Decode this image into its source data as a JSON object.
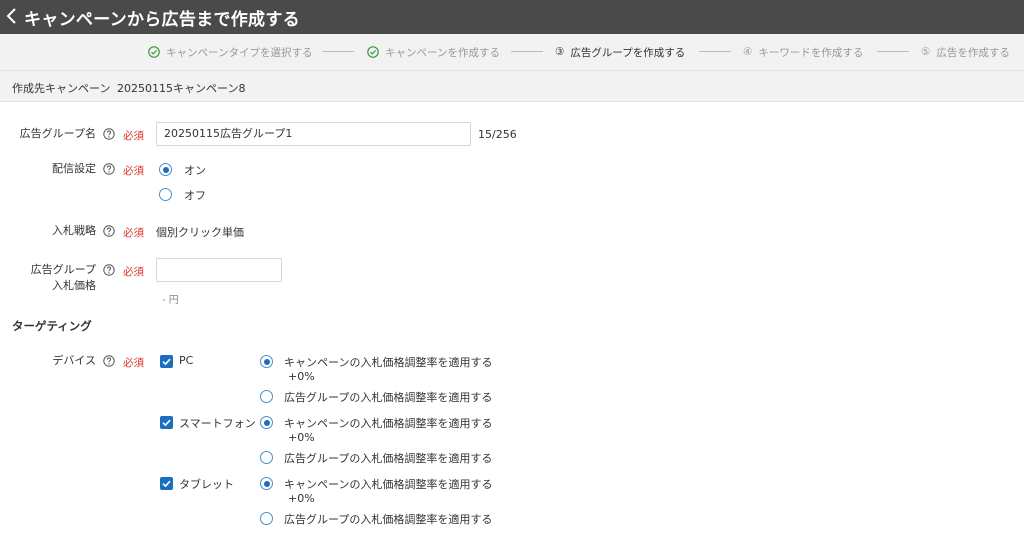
{
  "header": {
    "back_icon": "chevron-left-icon",
    "title": "キャンペーンから広告まで作成する"
  },
  "steps": [
    {
      "label": "キャンペーンタイプを選択する",
      "state": "done",
      "marker": ""
    },
    {
      "label": "キャンペーンを作成する",
      "state": "done",
      "marker": ""
    },
    {
      "label": "広告グループを作成する",
      "state": "active",
      "marker": "③"
    },
    {
      "label": "キーワードを作成する",
      "state": "pending",
      "marker": "④"
    },
    {
      "label": "広告を作成する",
      "state": "pending",
      "marker": "⑤"
    }
  ],
  "target": {
    "label": "作成先キャンペーン",
    "name": "20250115キャンペーン8"
  },
  "required_label": "必須",
  "ad_group_name": {
    "label": "広告グループ名",
    "value": "20250115広告グループ1",
    "counter": "15/256"
  },
  "delivery": {
    "label": "配信設定",
    "on": "オン",
    "off": "オフ",
    "selected": "on"
  },
  "bid_strategy": {
    "label": "入札戦略",
    "value": "個別クリック単価"
  },
  "bid_price": {
    "label_line1": "広告グループ",
    "label_line2": "入札価格",
    "value": "",
    "hint": "- 円"
  },
  "targeting": {
    "title": "ターゲティング"
  },
  "device": {
    "label": "デバイス",
    "option_campaign": "キャンペーンの入札価格調整率を適用する",
    "option_group": "広告グループの入札価格調整率を適用する",
    "items": [
      {
        "name": "PC",
        "checked": true,
        "adjust": "+0%"
      },
      {
        "name": "スマートフォン",
        "checked": true,
        "adjust": "+0%"
      },
      {
        "name": "タブレット",
        "checked": true,
        "adjust": "+0%"
      }
    ]
  },
  "colors": {
    "header_bg": "#4a4a4a",
    "accent": "#1a6fc1",
    "required": "#d9342b",
    "done_check": "#3a9a3a"
  }
}
